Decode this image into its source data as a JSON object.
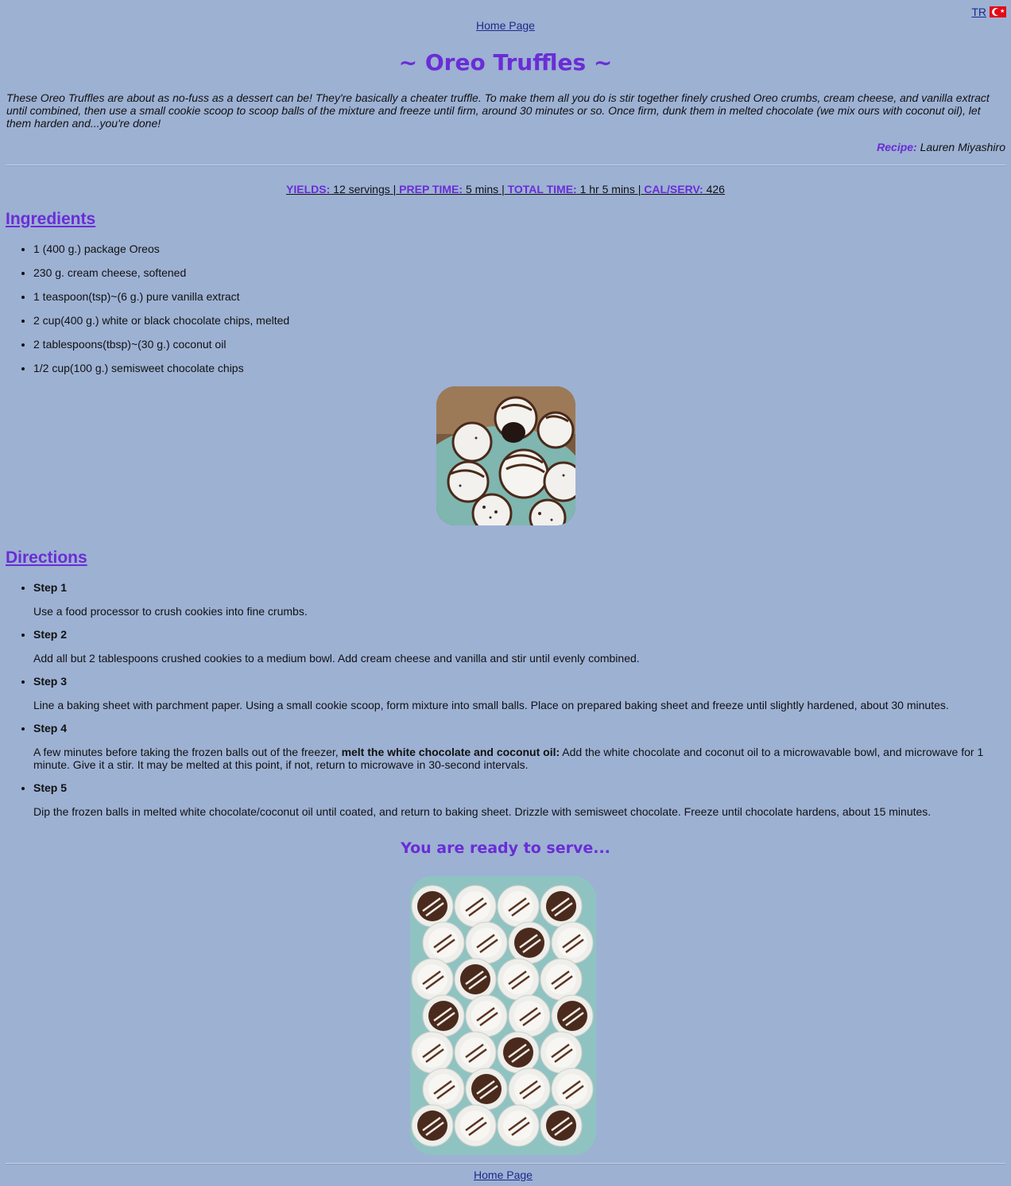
{
  "nav": {
    "home_label": "Home Page",
    "lang_label": "TR"
  },
  "recipe": {
    "title": "~ Oreo Truffles ~",
    "intro": "These Oreo Truffles are about as no-fuss as a dessert can be! They're basically a cheater truffle. To make them all you do is stir together finely crushed Oreo crumbs, cream cheese, and vanilla extract until combined, then use a small cookie scoop to scoop balls of the mixture and freeze until firm, around 30 minutes or so. Once firm, dunk them in melted chocolate (we mix ours with coconut oil), let them harden and...you're done!",
    "credit_label": "Recipe:",
    "credit_name": "Lauren Miyashiro"
  },
  "meta": {
    "yields_label": "YIELDS:",
    "yields_value": "12 servings",
    "prep_label": "PREP TIME:",
    "prep_value": "5 mins",
    "total_label": "TOTAL TIME:",
    "total_value": "1 hr 5 mins",
    "cal_label": "CAL/SERV:",
    "cal_value": "426",
    "separator": "|"
  },
  "ingredients": {
    "heading": "Ingredients",
    "items": [
      "1 (400 g.) package Oreos",
      "230 g. cream cheese, softened",
      "1 teaspoon(tsp)~(6 g.) pure vanilla extract",
      "2 cup(400 g.) white or black chocolate chips, melted",
      "2 tablespoons(tbsp)~(30 g.) coconut oil",
      "1/2 cup(100 g.) semisweet chocolate chips"
    ]
  },
  "directions": {
    "heading": "Directions",
    "steps": [
      {
        "title": "Step 1",
        "text": "Use a food processor to crush cookies into fine crumbs."
      },
      {
        "title": "Step 2",
        "text": "Add all but 2 tablespoons crushed cookies to a medium bowl. Add cream cheese and vanilla and stir until evenly combined."
      },
      {
        "title": "Step 3",
        "text": "Line a baking sheet with parchment paper. Using a small cookie scoop, form mixture into small balls. Place on prepared baking sheet and freeze until slightly hardened, about 30 minutes."
      },
      {
        "title": "Step 4",
        "text_before": "A few minutes before taking the frozen balls out of the freezer,",
        "text_bold": "melt the white chocolate and coconut oil:",
        "text_after": "Add the white chocolate and coconut oil to a microwavable bowl, and microwave for 1 minute. Give it a stir. It may be melted at this point, if not, return to microwave in 30-second intervals."
      },
      {
        "title": "Step 5",
        "text": "Dip the frozen balls in melted white chocolate/coconut oil until coated, and return to baking sheet. Drizzle with semisweet chocolate. Freeze until chocolate hardens, about 15 minutes."
      }
    ]
  },
  "serve": {
    "text": "You are ready to serve..."
  },
  "colors": {
    "background": "#9db1d3",
    "accent": "#6a2dd6",
    "link": "#1b2a8c"
  }
}
